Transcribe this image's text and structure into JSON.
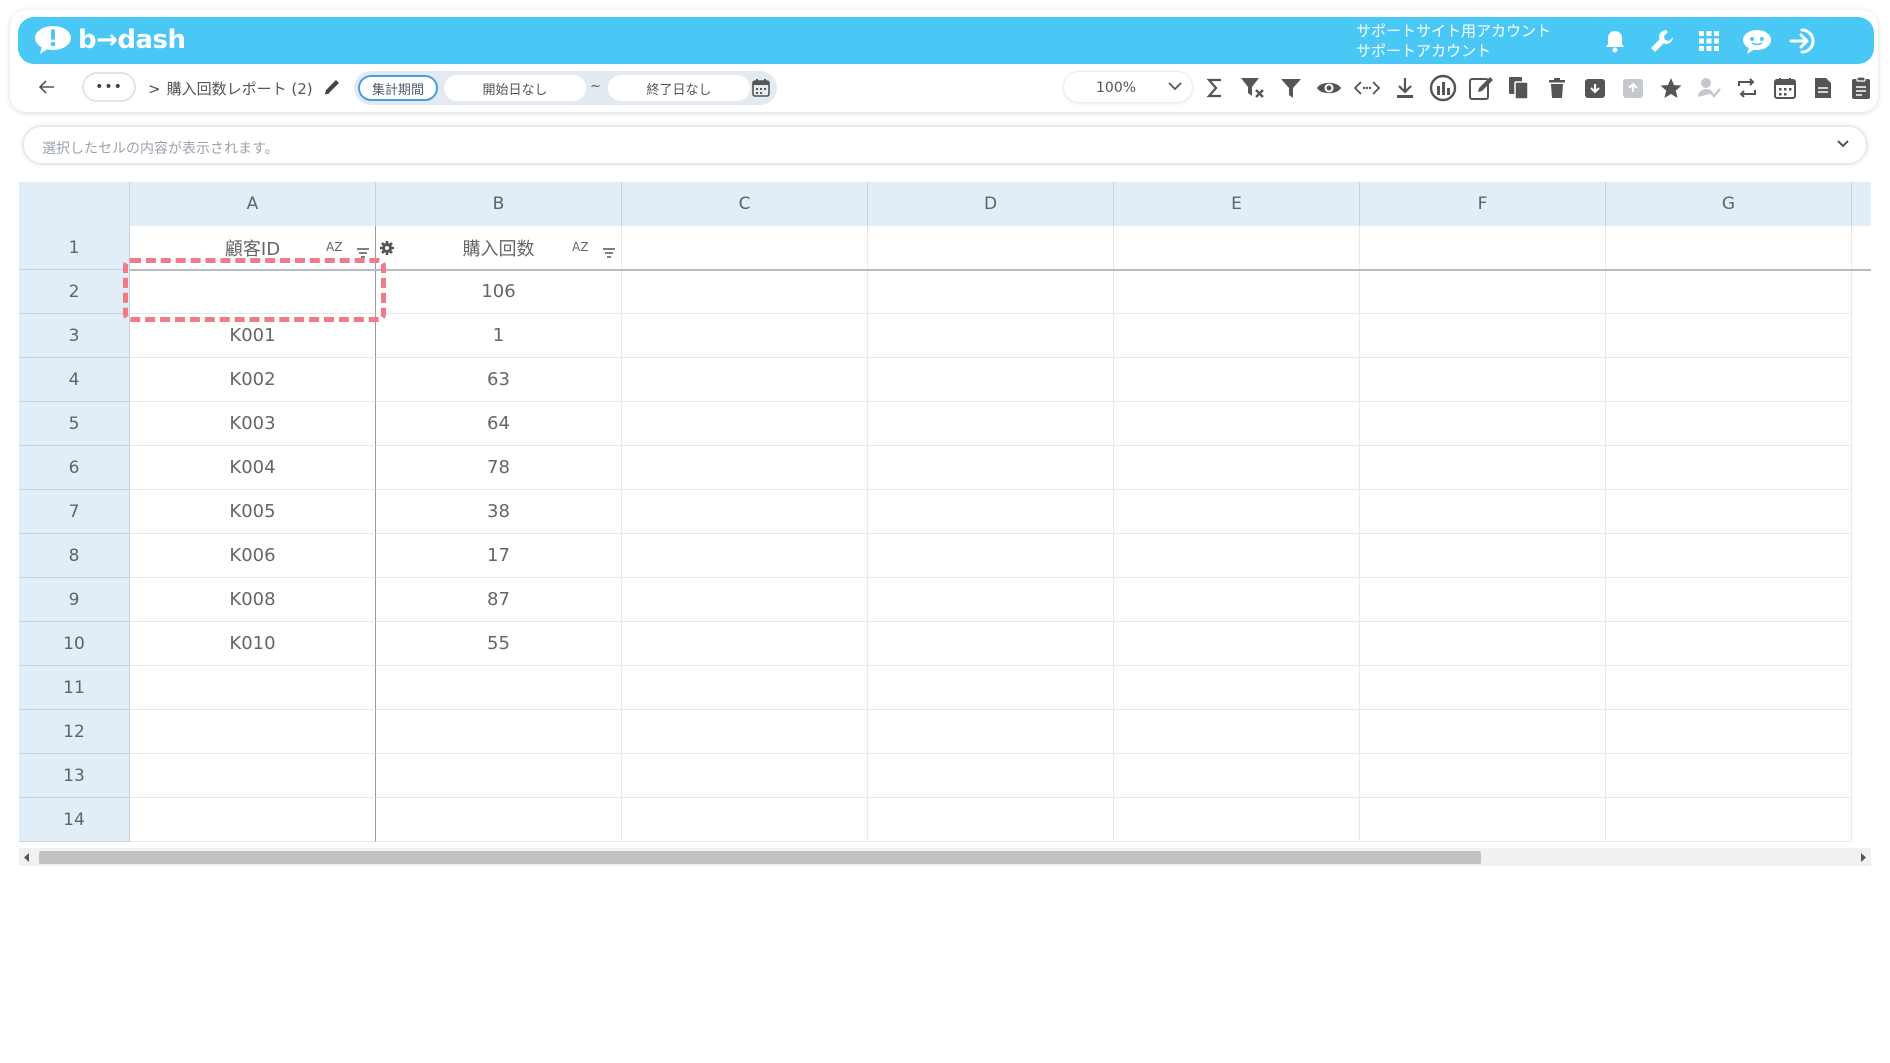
{
  "header": {
    "logo_text": "b→dash",
    "account_line1": "サポートサイト用アカウント",
    "account_line2": "サポートアカウント",
    "icons": [
      "bell-icon",
      "wrench-icon",
      "grid-icon",
      "chat-robot-icon",
      "logout-icon"
    ]
  },
  "toolbar": {
    "more_label": "•••",
    "breadcrumb_sep": ">",
    "report_title": "購入回数レポート (2)",
    "period_label": "集計期間",
    "start_date": "開始日なし",
    "tilde": "~",
    "end_date": "終了日なし",
    "zoom": "100%",
    "tool_icons": [
      "sigma-icon",
      "filter-clear-icon",
      "filter-icon",
      "eye-icon",
      "code-icon",
      "download-icon",
      "chart-icon",
      "edit-icon",
      "copy-icon",
      "trash-icon",
      "archive-icon",
      "archive-disabled-icon",
      "star-icon",
      "user-check-icon",
      "refresh-icon",
      "calendar-icon",
      "document-icon",
      "clipboard-icon"
    ]
  },
  "formula_bar": {
    "placeholder": "選択したセルの内容が表示されます。"
  },
  "grid": {
    "columns": [
      "A",
      "B",
      "C",
      "D",
      "E",
      "F",
      "G"
    ],
    "rows": [
      "1",
      "2",
      "3",
      "4",
      "5",
      "6",
      "7",
      "8",
      "9",
      "10",
      "11",
      "12",
      "13",
      "14"
    ],
    "sort_label": "AZ",
    "header_row": [
      "顧客ID",
      "購入回数"
    ],
    "data": [
      [
        "",
        "106"
      ],
      [
        "K001",
        "1"
      ],
      [
        "K002",
        "63"
      ],
      [
        "K003",
        "64"
      ],
      [
        "K004",
        "78"
      ],
      [
        "K005",
        "38"
      ],
      [
        "K006",
        "17"
      ],
      [
        "K008",
        "87"
      ],
      [
        "K010",
        "55"
      ]
    ]
  },
  "colors": {
    "header_bg": "#4ac8f5",
    "grid_header_bg": "#e1edf7",
    "highlight_dash": "#f07a88",
    "period_active_border": "#4a9ee0"
  }
}
